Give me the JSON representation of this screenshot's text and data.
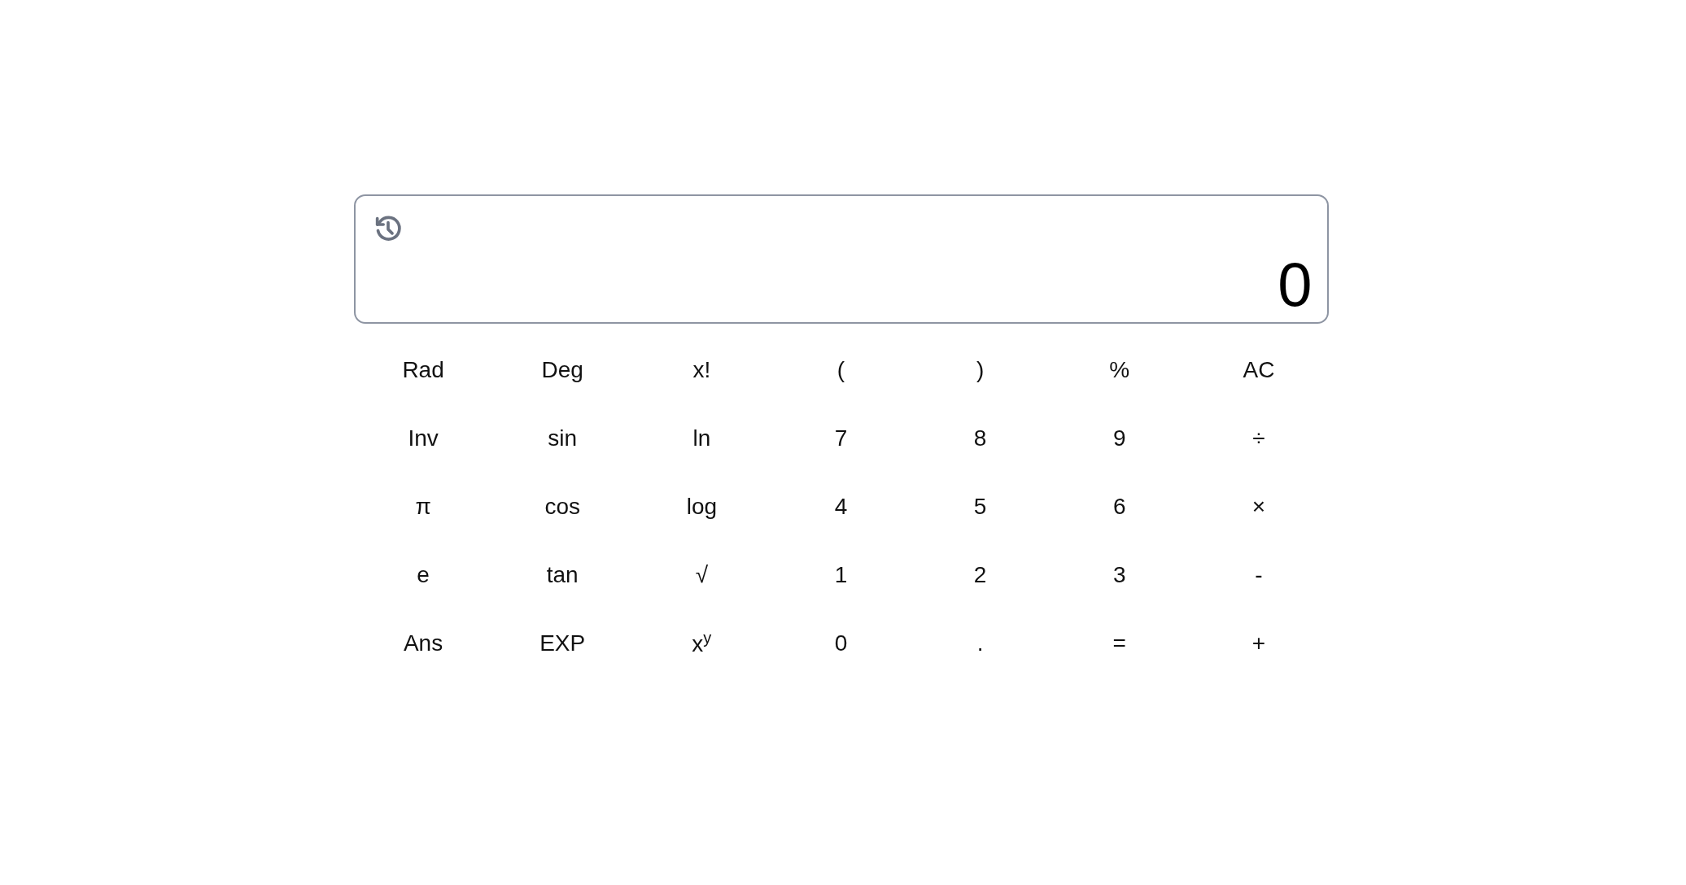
{
  "display": {
    "value": "0"
  },
  "keys": [
    [
      "Rad",
      "Deg",
      "x!",
      "(",
      ")",
      "%",
      "AC"
    ],
    [
      "Inv",
      "sin",
      "ln",
      "7",
      "8",
      "9",
      "÷"
    ],
    [
      "π",
      "cos",
      "log",
      "4",
      "5",
      "6",
      "×"
    ],
    [
      "e",
      "tan",
      "√",
      "1",
      "2",
      "3",
      "-"
    ],
    [
      "Ans",
      "EXP",
      "x$^{y}$",
      "0",
      ".",
      "=",
      "+"
    ]
  ]
}
